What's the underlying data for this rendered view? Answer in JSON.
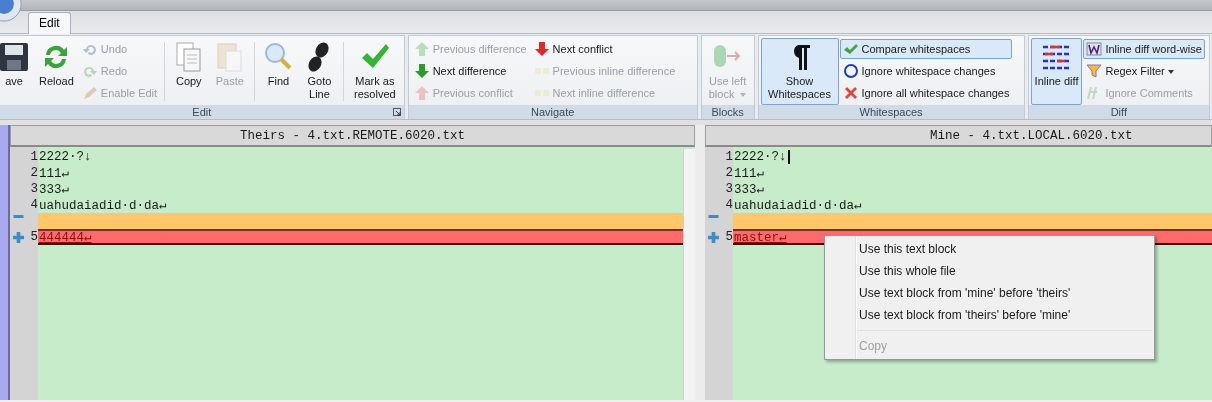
{
  "ribbon": {
    "tabs": [
      {
        "label": "Edit",
        "selected": true
      }
    ],
    "groups": [
      {
        "label": "Edit",
        "items": [
          {
            "kind": "large",
            "label": "ave",
            "disabled": false
          },
          {
            "kind": "large",
            "label": "Reload",
            "disabled": false
          },
          {
            "kind": "small",
            "label": "Undo",
            "disabled": true
          },
          {
            "kind": "small",
            "label": "Redo",
            "disabled": true
          },
          {
            "kind": "small",
            "label": "Enable Edit",
            "disabled": true
          },
          {
            "kind": "large",
            "label": "Copy",
            "disabled": false
          },
          {
            "kind": "large",
            "label": "Paste",
            "disabled": true
          },
          {
            "kind": "large",
            "label": "Find",
            "disabled": false
          },
          {
            "kind": "large",
            "label": "Goto Line",
            "disabled": false
          },
          {
            "kind": "large",
            "label": "Mark as resolved",
            "disabled": false
          }
        ]
      },
      {
        "label": "Navigate",
        "items": [
          {
            "kind": "small",
            "label": "Previous difference",
            "disabled": true
          },
          {
            "kind": "small",
            "label": "Next difference",
            "disabled": false
          },
          {
            "kind": "small",
            "label": "Previous conflict",
            "disabled": true
          },
          {
            "kind": "small",
            "label": "Next conflict",
            "disabled": false
          },
          {
            "kind": "small",
            "label": "Previous inline difference",
            "disabled": true
          },
          {
            "kind": "small",
            "label": "Next inline difference",
            "disabled": true
          }
        ]
      },
      {
        "label": "Blocks",
        "items": [
          {
            "kind": "large",
            "label": "Use left block",
            "disabled": true
          }
        ]
      },
      {
        "label": "Whitespaces",
        "items": [
          {
            "kind": "large",
            "label": "Show Whitespaces",
            "selected": true
          },
          {
            "kind": "small",
            "label": "Compare whitespaces",
            "selected": true
          },
          {
            "kind": "small",
            "label": "Ignore whitespace changes",
            "selected": false
          },
          {
            "kind": "small",
            "label": "Ignore all whitespace changes",
            "selected": false
          }
        ]
      },
      {
        "label": "Diff",
        "items": [
          {
            "kind": "large",
            "label": "Inline diff",
            "selected": true
          },
          {
            "kind": "small",
            "label": "Inline diff word-wise",
            "selected": true
          },
          {
            "kind": "small",
            "label": "Regex Filter",
            "selected": false
          },
          {
            "kind": "small",
            "label": "Ignore Comments",
            "disabled": true
          }
        ]
      }
    ]
  },
  "panes": [
    {
      "title": "Theirs - 4.txt.REMOTE.6020.txt",
      "lines": [
        {
          "kind": "equal",
          "number": "1",
          "text": "2222·?↓",
          "caret": false
        },
        {
          "kind": "equal",
          "number": "2",
          "text": "111↵",
          "caret": false
        },
        {
          "kind": "equal",
          "number": "3",
          "text": "333↵",
          "caret": false
        },
        {
          "kind": "equal",
          "number": "4",
          "text": "uahudaiadid·d·da↵",
          "caret": false
        },
        {
          "kind": "gap"
        },
        {
          "kind": "conflict",
          "number": "5",
          "text": "444444↵",
          "caret": false
        }
      ]
    },
    {
      "title": "Mine - 4.txt.LOCAL.6020.txt",
      "lines": [
        {
          "kind": "equal",
          "number": "1",
          "text": "2222·?↓",
          "caret": true
        },
        {
          "kind": "equal",
          "number": "2",
          "text": "111↵",
          "caret": false
        },
        {
          "kind": "equal",
          "number": "3",
          "text": "333↵",
          "caret": false
        },
        {
          "kind": "equal",
          "number": "4",
          "text": "uahudaiadid·d·da↵",
          "caret": false
        },
        {
          "kind": "gap"
        },
        {
          "kind": "conflict",
          "number": "5",
          "text": "master↵",
          "caret": false
        }
      ]
    }
  ],
  "context_menu": {
    "items": [
      {
        "kind": "item",
        "label": "Use this text block",
        "disabled": false
      },
      {
        "kind": "item",
        "label": "Use this whole file",
        "disabled": false
      },
      {
        "kind": "item",
        "label": "Use text block from 'mine' before 'theirs'",
        "disabled": false
      },
      {
        "kind": "item",
        "label": "Use text block from 'theirs' before 'mine'",
        "disabled": false
      },
      {
        "kind": "separator"
      },
      {
        "kind": "item",
        "label": "Copy",
        "disabled": true
      }
    ]
  }
}
